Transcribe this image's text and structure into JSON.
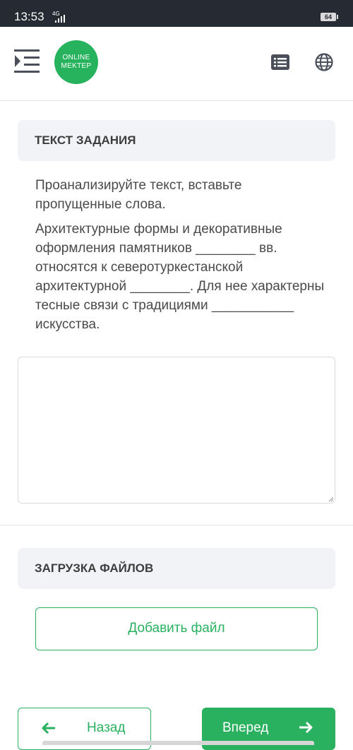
{
  "status_bar": {
    "time": "13:53",
    "network": "4G",
    "battery": "64"
  },
  "header": {
    "logo_line1": "ONLINE",
    "logo_line2": "MEKTEP",
    "brand_color": "#27b35d",
    "icons": [
      "menu-indent-icon",
      "list-icon",
      "globe-icon"
    ]
  },
  "task": {
    "heading": "ТЕКСТ ЗАДАНИЯ",
    "instruction": "Проанализируйте текст, вставьте пропущенные слова.",
    "body": "Архитектурные формы и декоративные оформления памятников ________ вв. относятся к северотуркестанской архитектурной ________. Для нее характерны тесные связи с традициями ___________ искусства.",
    "answer_value": ""
  },
  "upload": {
    "heading": "ЗАГРУЗКА ФАЙЛОВ",
    "add_file_label": "Добавить файл"
  },
  "navigation": {
    "back_label": "Назад",
    "next_label": "Вперед",
    "accent_color": "#2ab160"
  }
}
